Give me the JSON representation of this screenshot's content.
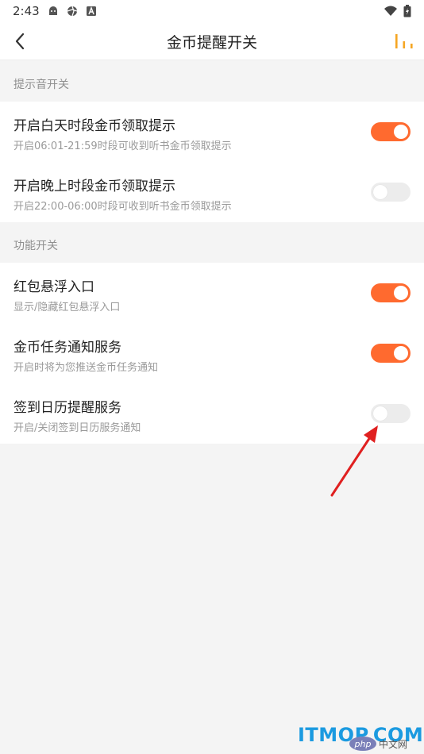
{
  "status_bar": {
    "time": "2:43",
    "icons": [
      "android-icon",
      "aperture-icon",
      "a-badge-icon"
    ],
    "right_icons": [
      "wifi-icon",
      "battery-charging-icon"
    ]
  },
  "nav": {
    "title": "金币提醒开关",
    "back_icon": "chevron-left-icon",
    "right_icon": "bar-chart-icon",
    "accent": "#f5a623"
  },
  "sections": [
    {
      "header": "提示音开关",
      "items": [
        {
          "title": "开启白天时段金币领取提示",
          "subtitle": "开启06:01-21:59时段可收到听书金币领取提示",
          "on": true
        },
        {
          "title": "开启晚上时段金币领取提示",
          "subtitle": "开启22:00-06:00时段可收到听书金币领取提示",
          "on": false
        }
      ]
    },
    {
      "header": "功能开关",
      "items": [
        {
          "title": "红包悬浮入口",
          "subtitle": "显示/隐藏红包悬浮入口",
          "on": true
        },
        {
          "title": "金币任务通知服务",
          "subtitle": "开启时将为您推送金币任务通知",
          "on": true
        },
        {
          "title": "签到日历提醒服务",
          "subtitle": "开启/关闭签到日历服务通知",
          "on": false
        }
      ]
    }
  ],
  "colors": {
    "toggle_on": "#ff6a2f",
    "toggle_off": "#ececec",
    "arrow": "#e02020"
  },
  "watermark": {
    "site": "ITMOP.COM",
    "php_logo": "php",
    "cn_text": "中文网"
  }
}
